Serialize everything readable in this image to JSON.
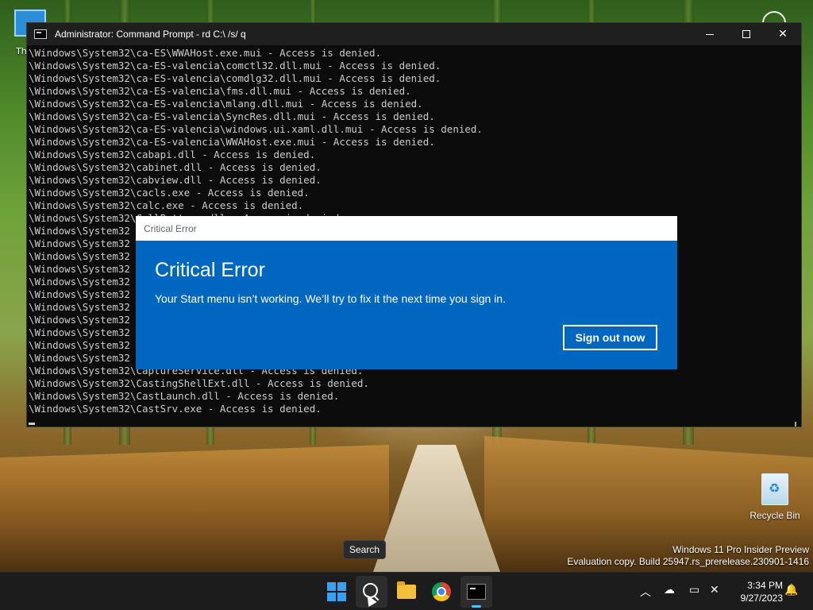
{
  "desktop": {
    "peek_label": "Th",
    "recycle_bin_label": "Recycle Bin",
    "watermark_line1": "Windows 11 Pro Insider Preview",
    "watermark_line2": "Evaluation copy. Build 25947.rs_prerelease.230901-1416"
  },
  "cmd_window": {
    "title": "Administrator: Command Prompt - rd  C:\\ /s/ q",
    "minimize_icon": "minimize-icon",
    "maximize_icon": "maximize-icon",
    "close_glyph": "✕",
    "lines": [
      "\\Windows\\System32\\ca-ES\\WWAHost.exe.mui - Access is denied.",
      "\\Windows\\System32\\ca-ES-valencia\\comctl32.dll.mui - Access is denied.",
      "\\Windows\\System32\\ca-ES-valencia\\comdlg32.dll.mui - Access is denied.",
      "\\Windows\\System32\\ca-ES-valencia\\fms.dll.mui - Access is denied.",
      "\\Windows\\System32\\ca-ES-valencia\\mlang.dll.mui - Access is denied.",
      "\\Windows\\System32\\ca-ES-valencia\\SyncRes.dll.mui - Access is denied.",
      "\\Windows\\System32\\ca-ES-valencia\\windows.ui.xaml.dll.mui - Access is denied.",
      "\\Windows\\System32\\ca-ES-valencia\\WWAHost.exe.mui - Access is denied.",
      "\\Windows\\System32\\cabapi.dll - Access is denied.",
      "\\Windows\\System32\\cabinet.dll - Access is denied.",
      "\\Windows\\System32\\cabview.dll - Access is denied.",
      "\\Windows\\System32\\cacls.exe - Access is denied.",
      "\\Windows\\System32\\calc.exe - Access is denied.",
      "\\Windows\\System32\\CallButtons.dll - Access is denied.",
      "\\Windows\\System32",
      "\\Windows\\System32",
      "\\Windows\\System32",
      "\\Windows\\System32",
      "\\Windows\\System32",
      "\\Windows\\System32",
      "\\Windows\\System32",
      "\\Windows\\System32",
      "\\Windows\\System32",
      "\\Windows\\System32",
      "\\Windows\\System32",
      "\\Windows\\System32\\CaptureService.dll - Access is denied.",
      "\\Windows\\System32\\CastingShellExt.dll - Access is denied.",
      "\\Windows\\System32\\CastLaunch.dll - Access is denied.",
      "\\Windows\\System32\\CastSrv.exe - Access is denied."
    ]
  },
  "dialog": {
    "titlebar": "Critical Error",
    "heading": "Critical Error",
    "message": "Your Start menu isn’t working. We’ll try to fix it the next time you sign in.",
    "button_label": "Sign out now"
  },
  "tooltip": {
    "text": "Search"
  },
  "taskbar": {
    "items": [
      {
        "name": "start-button",
        "icon": "windows-logo-icon"
      },
      {
        "name": "search-button",
        "icon": "search-icon"
      },
      {
        "name": "file-explorer-button",
        "icon": "folder-icon"
      },
      {
        "name": "chrome-button",
        "icon": "chrome-icon"
      },
      {
        "name": "command-prompt-button",
        "icon": "terminal-icon"
      }
    ],
    "tray": {
      "chevron": "︿",
      "onedrive": "☁",
      "network": "▭",
      "volume": "✕",
      "notifications": "🔔"
    },
    "time": "3:34 PM",
    "date": "9/27/2023"
  },
  "colors": {
    "dialog_blue": "#0067c0",
    "console_bg": "#0c0c0c",
    "console_text": "#cccccc",
    "taskbar_bg": "#1c1c1c",
    "accent": "#4cc2ff"
  }
}
